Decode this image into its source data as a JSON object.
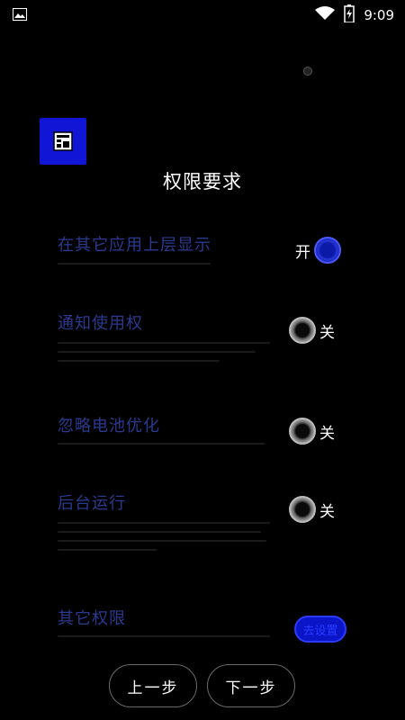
{
  "statusbar": {
    "time": "9:09",
    "icons": [
      "image-icon",
      "wifi-icon",
      "battery-charging-icon"
    ]
  },
  "page": {
    "title": "权限要求"
  },
  "permissions": [
    {
      "title": "在其它应用上层显示",
      "state_label": "开",
      "enabled": true
    },
    {
      "title": "通知使用权",
      "state_label": "关",
      "enabled": false
    },
    {
      "title": "忽略电池优化",
      "state_label": "关",
      "enabled": false
    },
    {
      "title": "后台运行",
      "state_label": "关",
      "enabled": false
    },
    {
      "title": "其它权限",
      "action_label": "去设置"
    }
  ],
  "footer": {
    "prev_label": "上一步",
    "next_label": "下一步"
  },
  "colors": {
    "background": "#000000",
    "accent": "#1015d6",
    "title_blue": "#2b3a8f"
  }
}
